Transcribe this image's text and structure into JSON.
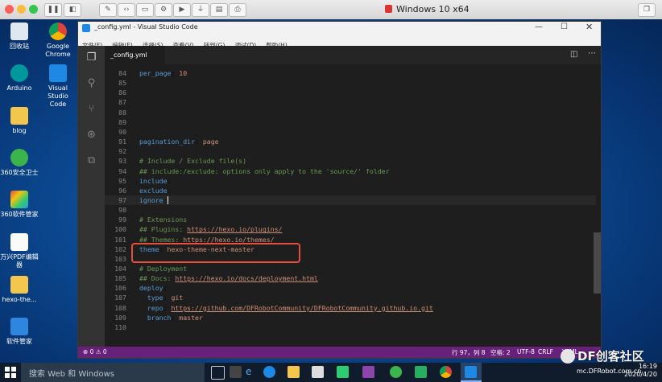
{
  "host": {
    "title": "Windows 10 x64"
  },
  "desktop": {
    "icons": [
      {
        "label": "回收站"
      },
      {
        "label": "Google Chrome"
      },
      {
        "label": "Arduino"
      },
      {
        "label": "Visual Studio Code"
      },
      {
        "label": "blog"
      },
      {
        "label": "360安全卫士"
      },
      {
        "label": "360软件管家"
      },
      {
        "label": "万兴PDF编辑器"
      },
      {
        "label": "hexo-the..."
      },
      {
        "label": "软件管家"
      }
    ]
  },
  "vscode": {
    "title": "_config.yml - Visual Studio Code",
    "menu": [
      "文件(F)",
      "编辑(E)",
      "选择(S)",
      "查看(V)",
      "转到(G)",
      "调试(D)",
      "帮助(H)"
    ],
    "tab": "_config.yml",
    "lines": [
      {
        "n": "84",
        "t": [
          {
            "s": "per_page",
            "c": "k"
          },
          {
            "s": ": ",
            "c": ""
          },
          {
            "s": "10",
            "c": "v"
          }
        ]
      },
      {
        "n": "85",
        "t": []
      },
      {
        "n": "86",
        "t": []
      },
      {
        "n": "87",
        "t": []
      },
      {
        "n": "88",
        "t": []
      },
      {
        "n": "89",
        "t": []
      },
      {
        "n": "90",
        "t": []
      },
      {
        "n": "91",
        "t": [
          {
            "s": "pagination_dir",
            "c": "k"
          },
          {
            "s": ": ",
            "c": ""
          },
          {
            "s": "page",
            "c": "v"
          }
        ]
      },
      {
        "n": "92",
        "t": []
      },
      {
        "n": "93",
        "t": [
          {
            "s": "# Include / Exclude file(s)",
            "c": "c"
          }
        ]
      },
      {
        "n": "94",
        "t": [
          {
            "s": "## include:/exclude: options only apply to the 'source/' folder",
            "c": "c"
          }
        ]
      },
      {
        "n": "95",
        "t": [
          {
            "s": "include",
            "c": "k"
          },
          {
            "s": ":",
            "c": ""
          }
        ]
      },
      {
        "n": "96",
        "t": [
          {
            "s": "exclude",
            "c": "k"
          },
          {
            "s": ":",
            "c": ""
          }
        ]
      },
      {
        "n": "97",
        "t": [
          {
            "s": "ignore",
            "c": "k"
          },
          {
            "s": ":",
            "c": ""
          }
        ]
      },
      {
        "n": "98",
        "t": []
      },
      {
        "n": "99",
        "t": [
          {
            "s": "# Extensions",
            "c": "c"
          }
        ]
      },
      {
        "n": "100",
        "t": [
          {
            "s": "## Plugins: ",
            "c": "c"
          },
          {
            "s": "https://hexo.io/plugins/",
            "c": "u"
          }
        ]
      },
      {
        "n": "101",
        "t": [
          {
            "s": "## Themes: ",
            "c": "c"
          },
          {
            "s": "https://hexo.io/themes/",
            "c": "u"
          }
        ]
      },
      {
        "n": "102",
        "t": [
          {
            "s": "theme",
            "c": "k"
          },
          {
            "s": ": ",
            "c": ""
          },
          {
            "s": "hexo-theme-next-master",
            "c": "v"
          }
        ]
      },
      {
        "n": "103",
        "t": []
      },
      {
        "n": "104",
        "t": [
          {
            "s": "# Deployment",
            "c": "c"
          }
        ]
      },
      {
        "n": "105",
        "t": [
          {
            "s": "## Docs: ",
            "c": "c"
          },
          {
            "s": "https://hexo.io/docs/deployment.html",
            "c": "u"
          }
        ]
      },
      {
        "n": "106",
        "t": [
          {
            "s": "deploy",
            "c": "k"
          },
          {
            "s": ":",
            "c": ""
          }
        ]
      },
      {
        "n": "107",
        "t": [
          {
            "s": "  type",
            "c": "k"
          },
          {
            "s": ": ",
            "c": ""
          },
          {
            "s": "git",
            "c": "v"
          }
        ]
      },
      {
        "n": "108",
        "t": [
          {
            "s": "  repo",
            "c": "k"
          },
          {
            "s": ": ",
            "c": ""
          },
          {
            "s": "https://github.com/DFRobotCommunity/DFRobotCommunity.github.io.git",
            "c": "u"
          }
        ]
      },
      {
        "n": "109",
        "t": [
          {
            "s": "  branch",
            "c": "k"
          },
          {
            "s": ": ",
            "c": ""
          },
          {
            "s": "master",
            "c": "v"
          }
        ]
      },
      {
        "n": "110",
        "t": []
      }
    ],
    "status": {
      "problems": "⊗ 0 ⚠ 0",
      "position": "行 97，列 8",
      "spaces": "空格: 2",
      "encoding": "UTF-8",
      "eol": "CRLF",
      "language": "YAML"
    }
  },
  "taskbar": {
    "search_placeholder": "搜索 Web 和 Windows",
    "time": "16:19",
    "date": "2020/4/20"
  },
  "watermark": {
    "brand": "DF创客社区",
    "url": "mc.DFRobot.com.cn"
  },
  "colors": {
    "status_purple": "#68217a",
    "highlight_box": "#e74c3c"
  }
}
